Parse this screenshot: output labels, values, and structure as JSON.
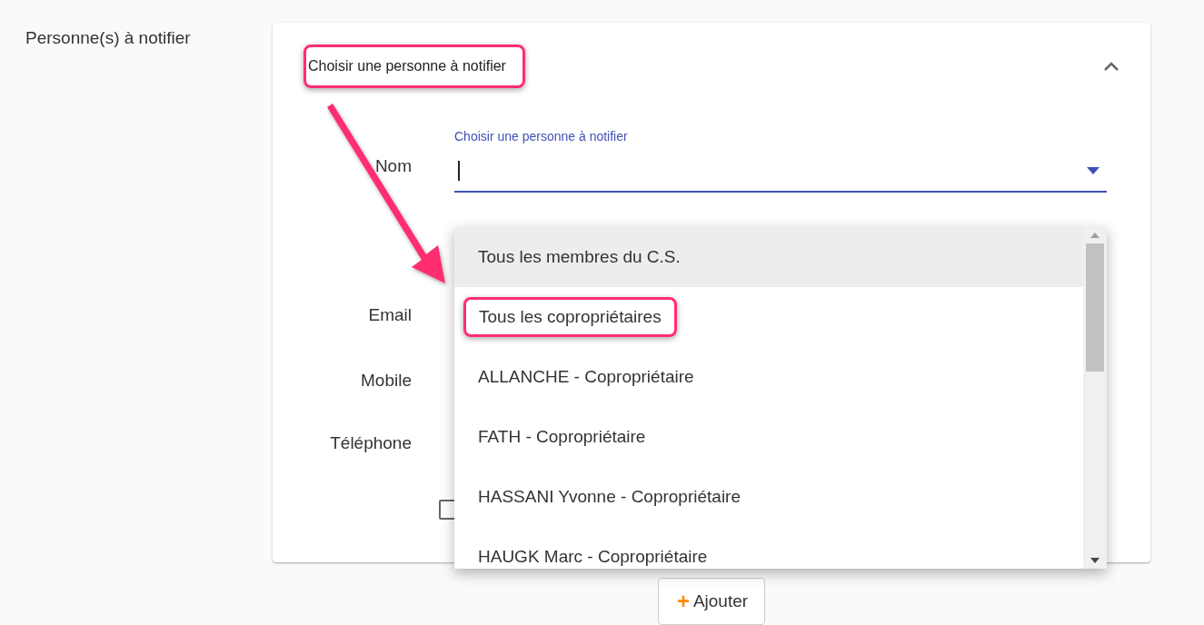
{
  "section_label": "Personne(s) à notifier",
  "panel": {
    "title": "Choisir une personne à notifier",
    "title_highlighted": true,
    "expanded": true
  },
  "form": {
    "name_label": "Nom",
    "select": {
      "label": "Choisir une personne à notifier",
      "focused": true,
      "open": true
    },
    "rows": [
      {
        "label": "Email"
      },
      {
        "label": "Mobile"
      },
      {
        "label": "Téléphone"
      }
    ],
    "checkbox": {
      "checked": false
    }
  },
  "options": [
    {
      "label": "Tous les membres du C.S.",
      "focused": true,
      "highlighted": false
    },
    {
      "label": "Tous les copropriétaires",
      "focused": false,
      "highlighted": true
    },
    {
      "label": "ALLANCHE - Copropriétaire",
      "focused": false,
      "highlighted": false
    },
    {
      "label": "FATH - Copropriétaire",
      "focused": false,
      "highlighted": false
    },
    {
      "label": "HASSANI Yvonne - Copropriétaire",
      "focused": false,
      "highlighted": false
    },
    {
      "label": "HAUGK Marc - Copropriétaire",
      "focused": false,
      "highlighted": false
    }
  ],
  "add_button": {
    "icon": "+",
    "label": "Ajouter"
  }
}
